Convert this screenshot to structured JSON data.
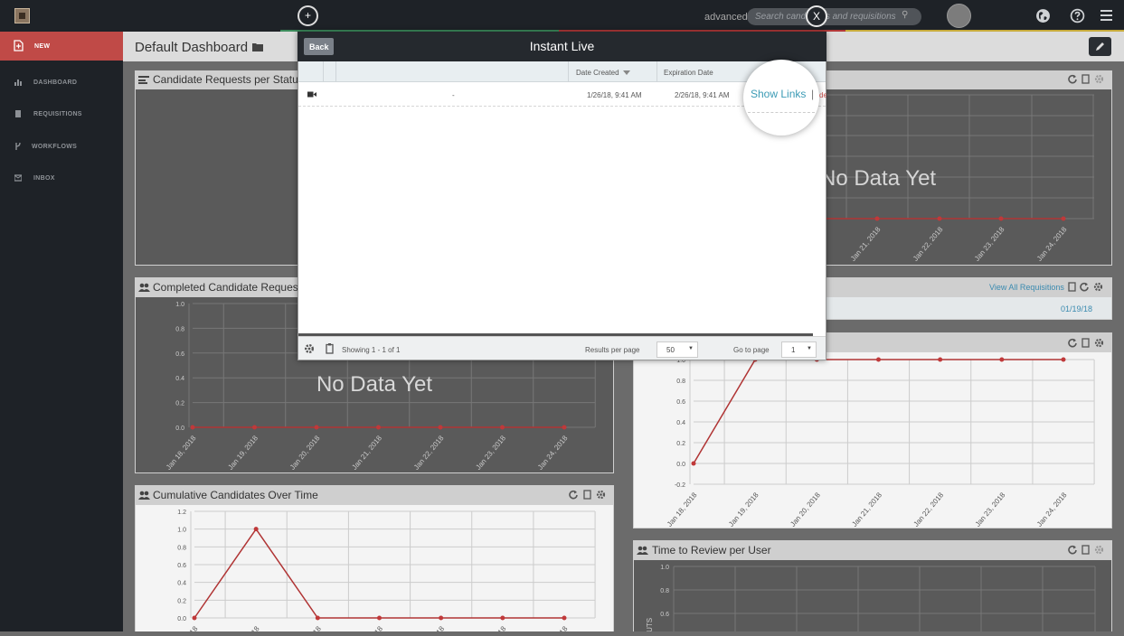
{
  "topbar": {
    "plus": "+",
    "advanced": "advanced",
    "search_placeholder": "Search candidates and requisitions",
    "close": "X"
  },
  "sidebar": {
    "items": [
      {
        "label": "NEW",
        "active": true
      },
      {
        "label": "DASHBOARD"
      },
      {
        "label": "REQUISITIONS"
      },
      {
        "label": "WORKFLOWS"
      },
      {
        "label": "INBOX"
      }
    ]
  },
  "dashboard": {
    "title": "Default Dashboard",
    "widgets": {
      "candidate_requests": {
        "title": "Candidate Requests per Status",
        "empty_text": "No Data Yet"
      },
      "completed_requests": {
        "title": "Completed Candidate Requests over Time",
        "empty_text": "No Data Yet"
      },
      "requisitions": {
        "link": "View All Requisitions",
        "date": "01/19/18"
      },
      "cumulative": {
        "title": "Cumulative Candidates Over Time"
      },
      "time_review": {
        "title": "Time to Review per User",
        "axis_fragment": "OUTS"
      }
    },
    "empty_text_right": "No Data Yet"
  },
  "modal": {
    "back": "Back",
    "title": "Instant Live",
    "columns": [
      "Date Created",
      "Expiration Date"
    ],
    "row": {
      "title": "-",
      "created": "1/26/18, 9:41 AM",
      "expires": "2/26/18, 9:41 AM",
      "link": "Show Links",
      "separator": "|"
    },
    "footer": {
      "showing": "Showing 1 - 1 of 1",
      "results_label": "Results per page",
      "results_value": "50",
      "goto_label": "Go to page",
      "goto_value": "1"
    }
  },
  "colors": {
    "accent": "#c04a47",
    "link": "#3b9bb5",
    "dark": "#1e2227",
    "line": "#c0393a"
  },
  "chart_data": [
    {
      "type": "line",
      "name": "Completed Candidate Requests over Time",
      "x": [
        "Jan 18, 2018",
        "Jan 19, 2018",
        "Jan 20, 2018",
        "Jan 21, 2018",
        "Jan 22, 2018",
        "Jan 23, 2018",
        "Jan 24, 2018"
      ],
      "values": [
        0,
        0,
        0,
        0,
        0,
        0,
        0
      ],
      "yticks": [
        "1.0",
        "0.8",
        "0.6",
        "0.4",
        "0.2",
        "0.0"
      ],
      "ylim": [
        0,
        1
      ]
    },
    {
      "type": "line",
      "name": "Completed Candidate Requests (right)",
      "x": [
        "Jan 18, 2018",
        "Jan 19, 2018",
        "Jan 20, 2018",
        "Jan 21, 2018",
        "Jan 22, 2018",
        "Jan 23, 2018",
        "Jan 24, 2018"
      ],
      "values": [
        0,
        1,
        1,
        1,
        1,
        1,
        1
      ],
      "yticks": [
        "1.0",
        "0.8",
        "0.6",
        "0.4",
        "0.2",
        "0.0",
        "-0.2"
      ],
      "ylim": [
        -0.2,
        1.0
      ]
    },
    {
      "type": "line",
      "name": "Cumulative Candidates Over Time",
      "x": [
        "Jan 18, 2018",
        "Jan 19, 2018",
        "Jan 20, 2018",
        "Jan 21, 2018",
        "Jan 22, 2018",
        "Jan 23, 2018",
        "Jan 24, 2018"
      ],
      "values": [
        0,
        1,
        0,
        0,
        0,
        0,
        0
      ],
      "yticks": [
        "1.2",
        "1.0",
        "0.8",
        "0.6",
        "0.4",
        "0.2",
        "0.0"
      ],
      "ylim": [
        0,
        1.2
      ]
    },
    {
      "type": "line",
      "name": "Candidate Requests per Status (right)",
      "x": [
        "Jan 21, 2018",
        "Jan 22, 2018",
        "Jan 23, 2018",
        "Jan 24, 2018"
      ],
      "values": [
        0,
        0,
        0,
        0
      ]
    },
    {
      "type": "line",
      "name": "Time to Review per User",
      "yticks": [
        "1.0",
        "0.8",
        "0.6"
      ]
    }
  ]
}
